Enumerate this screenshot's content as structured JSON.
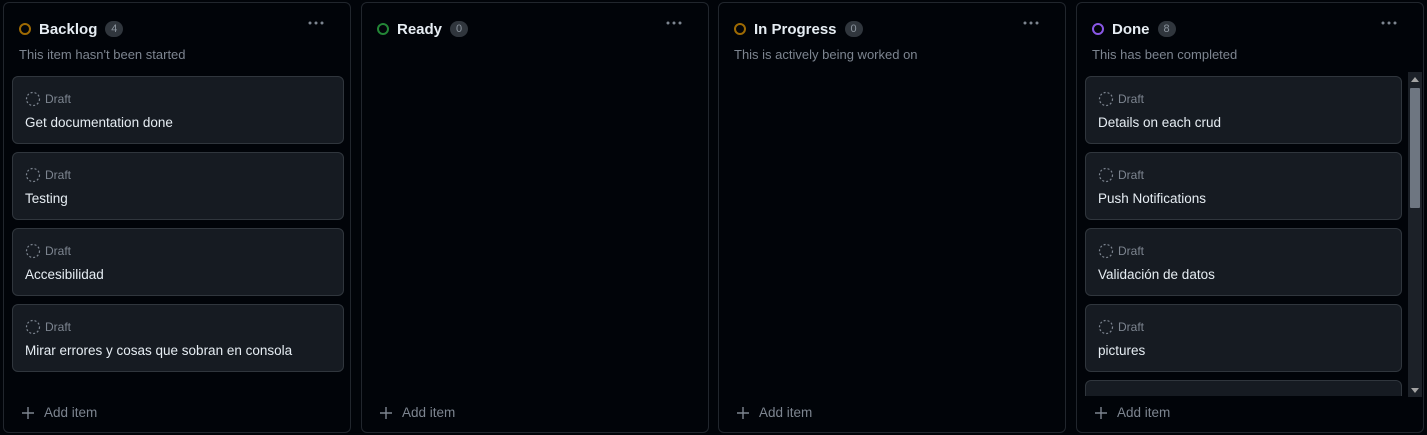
{
  "columns": [
    {
      "title": "Backlog",
      "count": "4",
      "description": "This item hasn't been started",
      "status_color": "#9e6a03",
      "cards": [
        {
          "draft_label": "Draft",
          "title": "Get documentation done"
        },
        {
          "draft_label": "Draft",
          "title": "Testing"
        },
        {
          "draft_label": "Draft",
          "title": "Accesibilidad"
        },
        {
          "draft_label": "Draft",
          "title": "Mirar errores y cosas que sobran en consola"
        }
      ],
      "add_item_label": "Add item"
    },
    {
      "title": "Ready",
      "count": "0",
      "description": "",
      "status_color": "#238636",
      "cards": [],
      "add_item_label": "Add item"
    },
    {
      "title": "In Progress",
      "count": "0",
      "description": "This is actively being worked on",
      "status_color": "#9e6a03",
      "cards": [],
      "add_item_label": "Add item"
    },
    {
      "title": "Done",
      "count": "8",
      "description": "This has been completed",
      "status_color": "#8957e5",
      "cards": [
        {
          "draft_label": "Draft",
          "title": "Details on each crud"
        },
        {
          "draft_label": "Draft",
          "title": "Push Notifications"
        },
        {
          "draft_label": "Draft",
          "title": "Validación de datos"
        },
        {
          "draft_label": "Draft",
          "title": "pictures"
        }
      ],
      "add_item_label": "Add item"
    }
  ],
  "icons": {
    "status": "circle-status-icon",
    "more": "kebab-horizontal-icon",
    "draft": "issue-draft-icon",
    "add": "plus-icon"
  }
}
